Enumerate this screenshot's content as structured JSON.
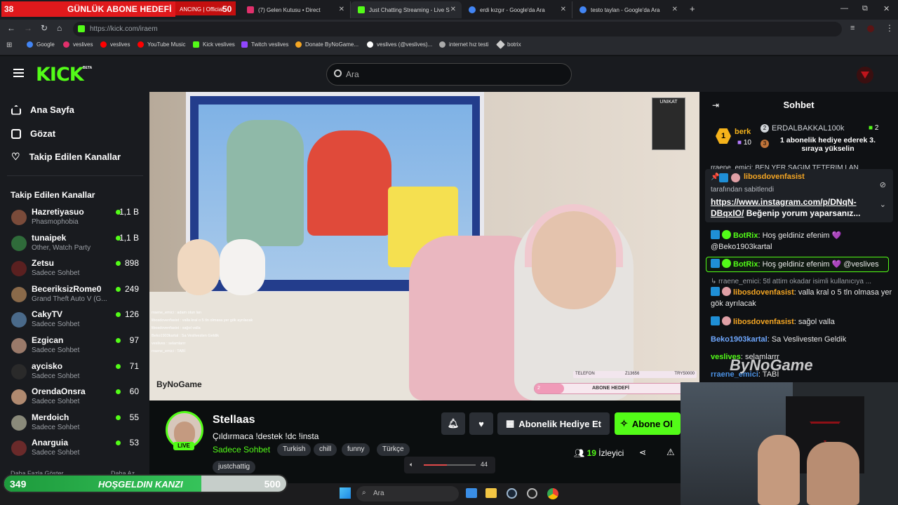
{
  "browser": {
    "tabs": [
      {
        "label": "(7) Gelen Kutusu • Direct",
        "color": "#e1306c"
      },
      {
        "label": "Just Chatting Streaming - Live S",
        "color": "#53fc18"
      },
      {
        "label": "erdi kızgır - Google'da Ara",
        "color": "#4285f4"
      },
      {
        "label": "testo taylan - Google'da Ara",
        "color": "#4285f4"
      }
    ],
    "promo_tab_text": "ANCING | Official",
    "new_tab": "+",
    "url": "https://kick.com/iraem",
    "window_controls": [
      "—",
      "⧉",
      "✕"
    ],
    "bookmarks": [
      {
        "label": "Google",
        "color": "#4285f4"
      },
      {
        "label": "veslives",
        "color": "#e1306c"
      },
      {
        "label": "veslives",
        "color": "#ff0000"
      },
      {
        "label": "YouTube Music",
        "color": "#ff0000"
      },
      {
        "label": "Kick veslives",
        "color": "#53fc18"
      },
      {
        "label": "Twitch veslives",
        "color": "#9146ff"
      },
      {
        "label": "Donate ByNoGame...",
        "color": "#f5a623"
      },
      {
        "label": "veslives (@veslives)...",
        "color": "#ffffff"
      },
      {
        "label": "internet hız testi",
        "color": "#aaaaaa"
      },
      {
        "label": "botrix",
        "color": "#cccccc"
      }
    ]
  },
  "top_goal": {
    "left": "38",
    "title": "GÜNLÜK ABONE HEDEFİ",
    "right": "50"
  },
  "site": {
    "logo": "KICK",
    "logo_badge": "BETA",
    "search_placeholder": "Ara",
    "accent": "#53fc18"
  },
  "sidebar": {
    "nav": [
      {
        "label": "Ana Sayfa",
        "icon": "home-icon"
      },
      {
        "label": "Gözat",
        "icon": "browse-icon"
      },
      {
        "label": "Takip Edilen Kanallar",
        "icon": "heart-icon"
      }
    ],
    "followed_title": "Takip Edilen Kanallar",
    "channels": [
      {
        "name": "Hazretiyasuo",
        "category": "Phasmophobia",
        "viewers": "1,1 B",
        "color": "#7a4b3a"
      },
      {
        "name": "tunaipek",
        "category": "Other, Watch Party",
        "viewers": "1,1 B",
        "color": "#2f6b3a"
      },
      {
        "name": "Zetsu",
        "category": "Sadece Sohbet",
        "viewers": "898",
        "color": "#5a2020"
      },
      {
        "name": "BeceriksizRome0",
        "category": "Grand Theft Auto V (G...",
        "viewers": "249",
        "color": "#8a6a4a"
      },
      {
        "name": "CakyTV",
        "category": "Sadece Sohbet",
        "viewers": "126",
        "color": "#4a6a8a"
      },
      {
        "name": "Ezgican",
        "category": "Sadece Sohbet",
        "viewers": "97",
        "color": "#9a7a6a"
      },
      {
        "name": "aycisko",
        "category": "Sadece Sohbet",
        "viewers": "71",
        "color": "#2a2a2a"
      },
      {
        "name": "OrendaOnsra",
        "category": "Sadece Sohbet",
        "viewers": "60",
        "color": "#b08a70"
      },
      {
        "name": "Merdoich",
        "category": "Sadece Sohbet",
        "viewers": "55",
        "color": "#8a8a7a"
      },
      {
        "name": "Anarguia",
        "category": "Sadece Sohbet",
        "viewers": "53",
        "color": "#6a2a2a"
      }
    ],
    "show_more": "Daha Fazla Göster",
    "show_less": "Daha Az"
  },
  "chat": {
    "title": "Sohbet",
    "leaderboard": {
      "first_name": "berk",
      "first_count": "10",
      "second_name": "ERDALBAKKAL100k",
      "second_count": "2",
      "note": "1 abonelik hediye ederek 3. sıraya yükselin"
    },
    "partial_top": "rraene_emici: BEN YER SAGIM TETERIM LAN",
    "pinned": {
      "user": "libosdovenfasist",
      "by": "tarafından sabitlendi",
      "link": "https://www.instagram.com/p/DNqN-DBqxIO/",
      "text": "Beğenip yorum yaparsanız..."
    },
    "messages": [
      {
        "user": "BotRix",
        "ucolor": "#53fc18",
        "text": ": Hoş geldiniz efenim 💜 @Beko1903kartal"
      },
      {
        "user": "BotRix",
        "ucolor": "#53fc18",
        "text": ": Hoş geldiniz efenim 💜 @veslives"
      },
      {
        "reply": "↳ rraene_emici: 5tl attim okadar isimli kullanıcıya ..."
      },
      {
        "user": "libosdovenfasist",
        "ucolor": "#f5a623",
        "text": ": valla kral o 5 tln olmasa yer gök ayrılacak"
      },
      {
        "user": "libosdovenfasist",
        "ucolor": "#f5a623",
        "text": ": sağol valla"
      },
      {
        "user": "Beko1903kartal",
        "ucolor": "#6fa8ff",
        "text": ": Sa Veslivesten Geldik"
      },
      {
        "user": "veslives",
        "ucolor": "#53fc18",
        "text": ": selamlarrr"
      },
      {
        "user": "rraene_emici",
        "ucolor": "#4a90e2",
        "text": ": TABİ"
      }
    ],
    "watermark": "ByNoGame"
  },
  "video_overlay": {
    "brand": "UNIKAT",
    "small_chat": [
      "rraene_emici : adam olun lan",
      "libosdovenfasist : valla kral o 5 tln olmasa yer gök ayrılacak",
      "libosdovenfasist : sağol valla",
      "Beko1903kartal : Sa Veslivesten Geldik",
      "veslives : selamlarrr",
      "rraene_emici : TABİ"
    ],
    "bynogame": "ByNoGame",
    "donation_label": "TELEFON",
    "donation_amount": "Z13656",
    "donation_goal": "TRY50000",
    "sub_goal_num": "2",
    "sub_goal": "ABONE HEDEFİ"
  },
  "channel": {
    "name": "Stellaas",
    "live": "LIVE",
    "title": "Çıldırmaca !destek !dc !insta",
    "category": "Sadece Sohbet",
    "tags": [
      "Turkish",
      "chill",
      "funny",
      "Türkçe",
      "justchattig"
    ],
    "gift_button": "Abonelik Hediye Et",
    "subscribe_button": "Abone Ol",
    "viewers": "19",
    "viewers_label": "İzleyici"
  },
  "volume": {
    "value": "44",
    "level": 0.44
  },
  "bottom_goal": {
    "current": "349",
    "title": "HOŞGELDIN KANZI",
    "target": "500",
    "progress": 0.698
  },
  "taskbar": {
    "search": "Ara"
  }
}
